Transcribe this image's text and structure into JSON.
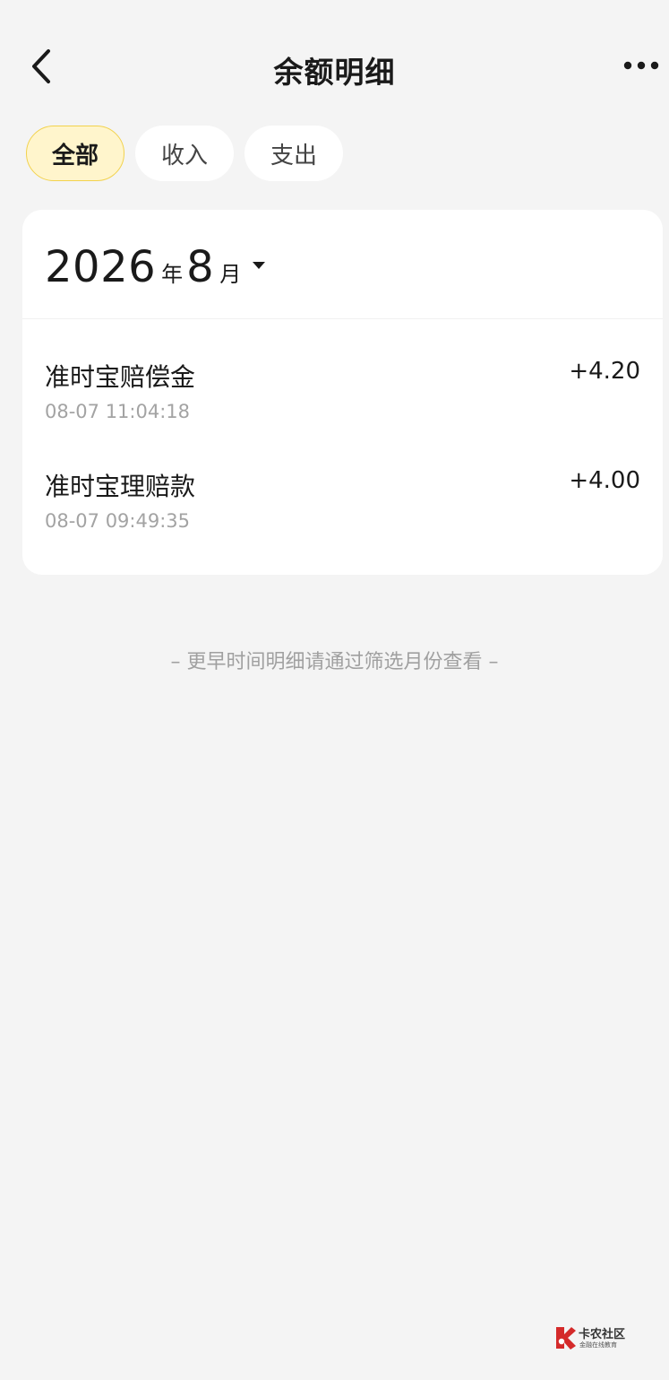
{
  "header": {
    "title": "余额明细",
    "back_icon": "chevron-left-icon",
    "more_icon": "more-horizontal-icon"
  },
  "tabs": [
    {
      "label": "全部",
      "active": true
    },
    {
      "label": "收入",
      "active": false
    },
    {
      "label": "支出",
      "active": false
    }
  ],
  "month_selector": {
    "year": "2026",
    "year_unit": "年",
    "month": "8",
    "month_unit": "月"
  },
  "transactions": [
    {
      "name": "准时宝赔偿金",
      "time": "08-07 11:04:18",
      "amount": "+4.20"
    },
    {
      "name": "准时宝理赔款",
      "time": "08-07 09:49:35",
      "amount": "+4.00"
    }
  ],
  "footer_note": "– 更早时间明细请通过筛选月份查看 –",
  "watermark": {
    "name": "卡农社区",
    "subtitle": "金融在线教育"
  },
  "colors": {
    "background": "#f4f4f4",
    "active_tab_bg": "#fff5cc",
    "active_tab_border": "#f2d24d",
    "secondary_text": "#a3a3a3"
  }
}
